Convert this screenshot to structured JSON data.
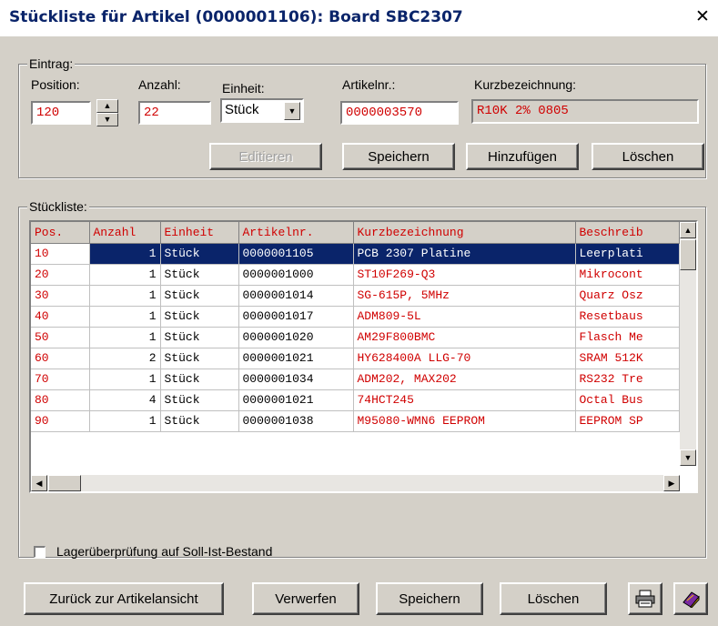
{
  "window": {
    "title": "Stückliste für Artikel (0000001106): Board SBC2307"
  },
  "entry": {
    "group_label": "Eintrag:",
    "position_label": "Position:",
    "position_value": "120",
    "quantity_label": "Anzahl:",
    "quantity_value": "22",
    "unit_label": "Einheit:",
    "unit_value": "Stück",
    "article_label": "Artikelnr.:",
    "article_value": "0000003570",
    "short_label": "Kurzbezeichnung:",
    "short_value": "R10K 2% 0805",
    "buttons": {
      "edit": "Editieren",
      "save": "Speichern",
      "add": "Hinzufügen",
      "delete": "Löschen"
    }
  },
  "list": {
    "group_label": "Stückliste:",
    "columns": [
      "Pos.",
      "Anzahl",
      "Einheit",
      "Artikelnr.",
      "Kurzbezeichnung",
      "Beschreib"
    ],
    "rows": [
      [
        "10",
        "1",
        "Stück",
        "0000001105",
        "PCB 2307 Platine",
        "Leerplati"
      ],
      [
        "20",
        "1",
        "Stück",
        "0000001000",
        "ST10F269-Q3",
        "Mikrocont"
      ],
      [
        "30",
        "1",
        "Stück",
        "0000001014",
        "SG-615P, 5MHz",
        "Quarz Osz"
      ],
      [
        "40",
        "1",
        "Stück",
        "0000001017",
        "ADM809-5L",
        "Resetbaus"
      ],
      [
        "50",
        "1",
        "Stück",
        "0000001020",
        "AM29F800BMC",
        "Flasch Me"
      ],
      [
        "60",
        "2",
        "Stück",
        "0000001021",
        "HY628400A LLG-70",
        "SRAM 512K"
      ],
      [
        "70",
        "1",
        "Stück",
        "0000001034",
        "ADM202, MAX202",
        "RS232 Tre"
      ],
      [
        "80",
        "4",
        "Stück",
        "0000001021",
        "74HCT245",
        "Octal Bus"
      ],
      [
        "90",
        "1",
        "Stück",
        "0000001038",
        "M95080-WMN6 EEPROM",
        "EEPROM SP"
      ]
    ],
    "selected_row": 0
  },
  "options": {
    "stock_check_label": "Lagerüberprüfung auf Soll-Ist-Bestand",
    "stock_check_checked": false
  },
  "footer": {
    "back": "Zurück zur Artikelansicht",
    "discard": "Verwerfen",
    "save": "Speichern",
    "delete": "Löschen"
  },
  "icons": [
    "close-icon",
    "spin-up-icon",
    "spin-down-icon",
    "dropdown-arrow-icon",
    "printer-icon",
    "book-icon"
  ],
  "colors": {
    "title_text": "#0a246a",
    "value_text": "#d00000",
    "selection": "#0a246a",
    "face": "#d4d0c8"
  }
}
